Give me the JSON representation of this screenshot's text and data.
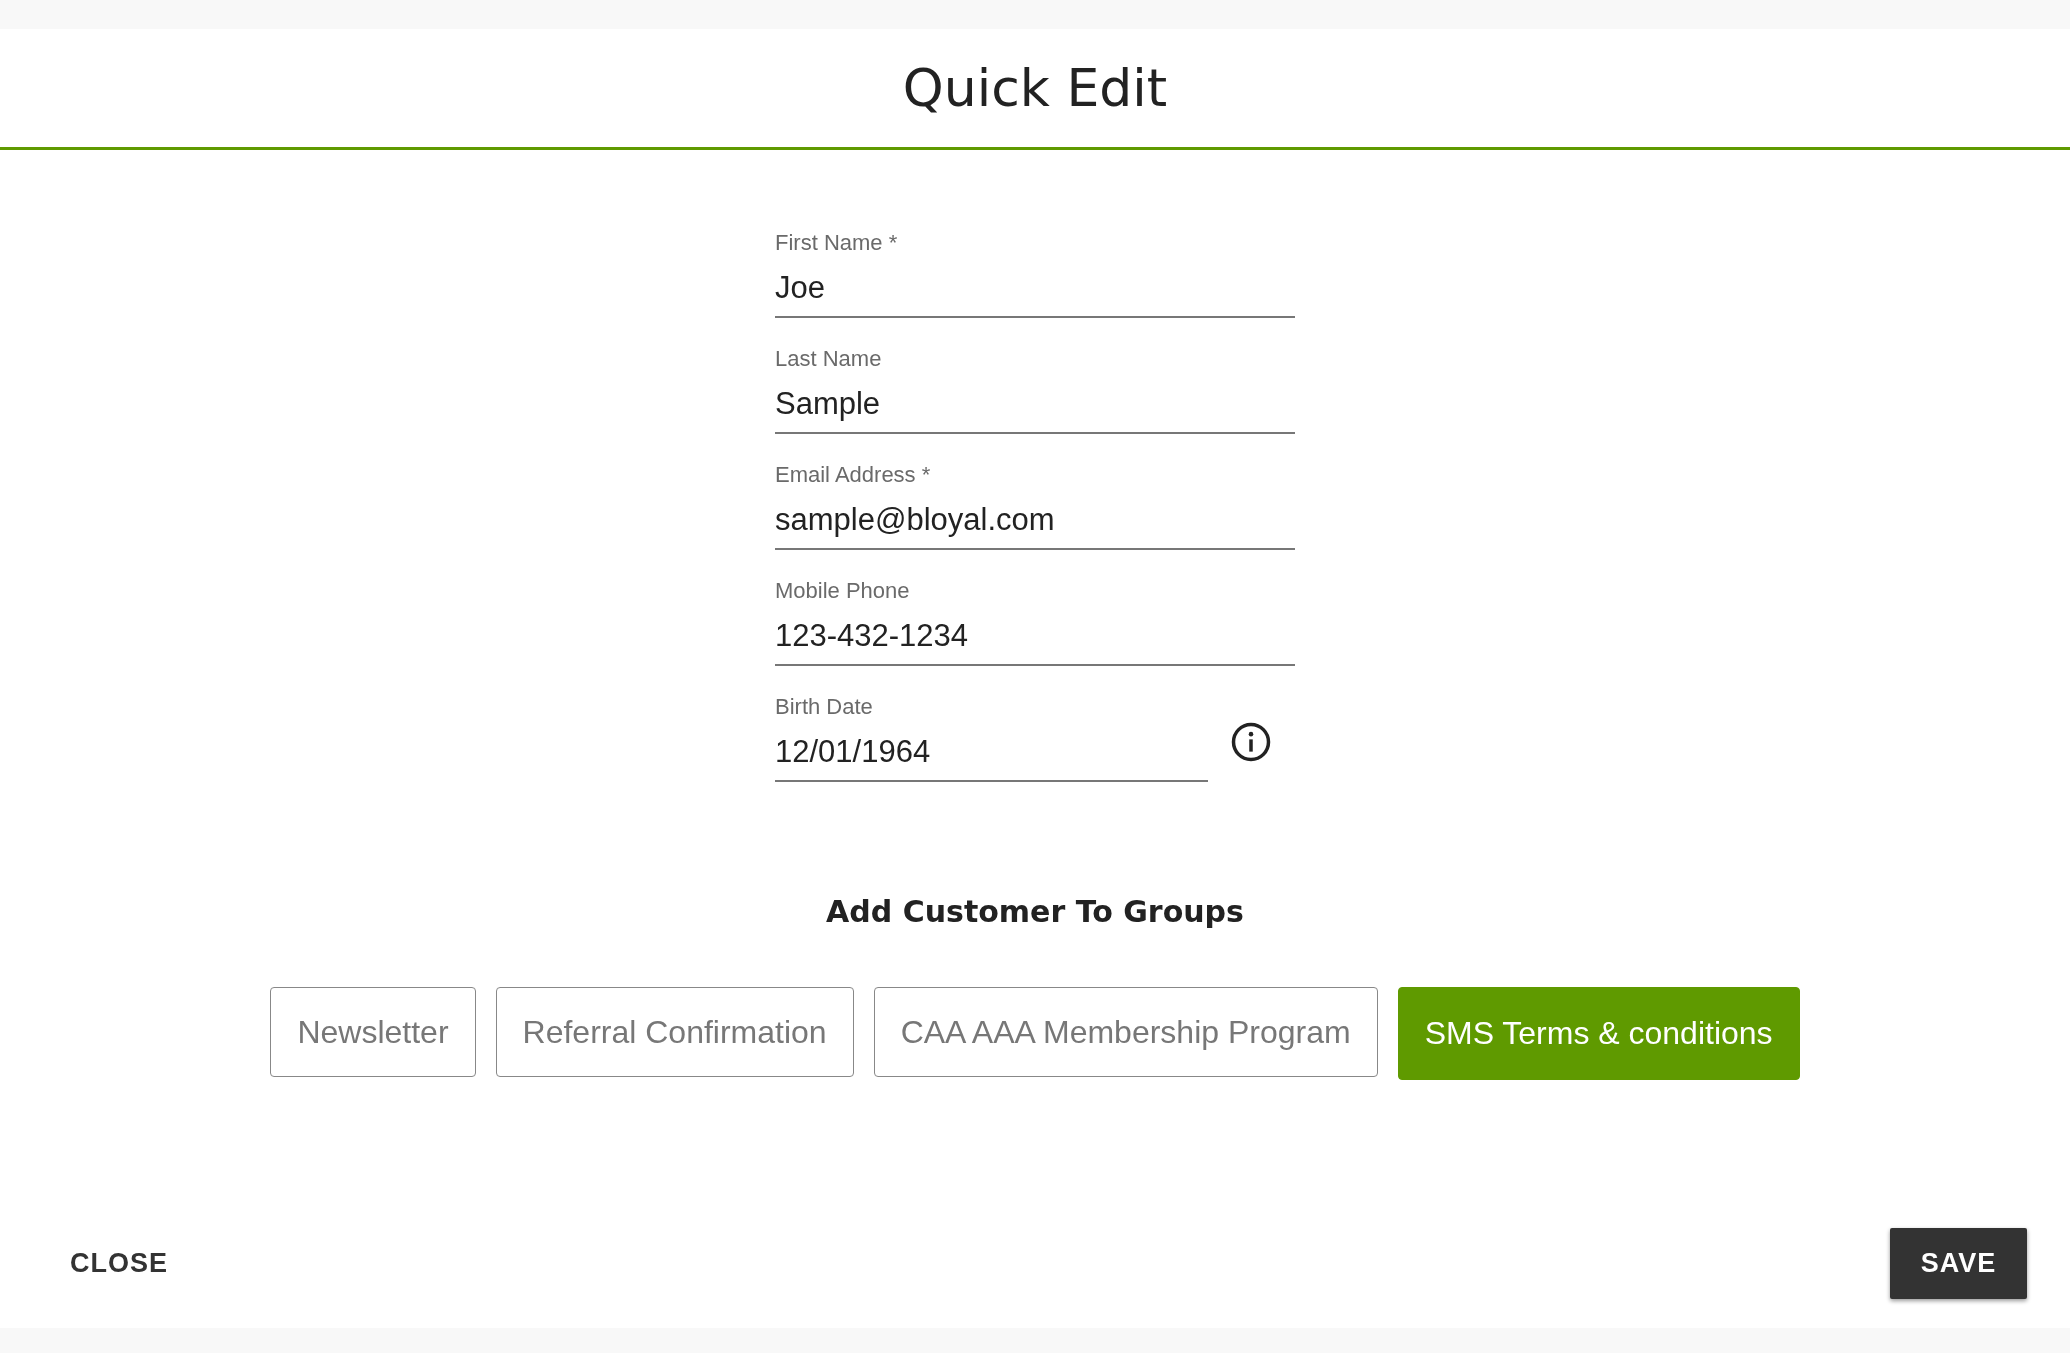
{
  "dialog": {
    "title": "Quick Edit"
  },
  "fields": [
    {
      "label": "First Name *",
      "value": "Joe",
      "kind": "text"
    },
    {
      "label": "Last Name",
      "value": "Sample",
      "kind": "text"
    },
    {
      "label": "Email Address *",
      "value": "sample@bloyal.com",
      "kind": "text"
    },
    {
      "label": "Mobile Phone",
      "value": "123-432-1234",
      "kind": "text"
    },
    {
      "label": "Birth Date",
      "value": "12/01/1964",
      "kind": "date"
    }
  ],
  "groups": {
    "heading": "Add Customer To Groups",
    "items": [
      {
        "label": "Newsletter",
        "selected": false
      },
      {
        "label": "Referral Confirmation",
        "selected": false
      },
      {
        "label": "CAA AAA Membership Program",
        "selected": false
      },
      {
        "label": "SMS Terms & conditions",
        "selected": true
      }
    ]
  },
  "buttons": {
    "close": "CLOSE",
    "save": "SAVE"
  }
}
